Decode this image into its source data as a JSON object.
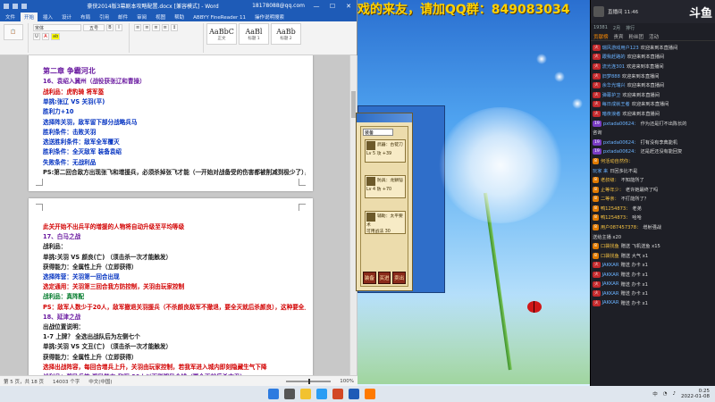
{
  "watermark": "想下载该游戏的来友，请加QQ群：849083034",
  "word": {
    "title": "豪侠2014版3幕剧本攻略配置.docx [兼容模式] - Word",
    "qa_user": "18178088@qq.com",
    "tabs": [
      "文件",
      "开始",
      "插入",
      "设计",
      "布局",
      "引用",
      "邮件",
      "审阅",
      "视图",
      "帮助",
      "ABBYY FineReader 11",
      "操作说明搜索"
    ],
    "font_name": "宋体",
    "font_size": "五号",
    "styles": [
      {
        "sample": "AaBbC",
        "label": "正文"
      },
      {
        "sample": "AaBl",
        "label": "标题 1"
      },
      {
        "sample": "AaBb",
        "label": "标题 2"
      }
    ],
    "page1": [
      {
        "text": "第二章 争霸河北",
        "cls": "chapter"
      },
      {
        "text": "16、袁绍入冀州（战役获张辽和曹操）",
        "cls": "b purple"
      },
      {
        "text": "战利品：虎豹骑 将军盔",
        "cls": "b red"
      },
      {
        "text": "单挑:张辽 VS 关羽(平)",
        "cls": "b blue"
      },
      {
        "text": "胜利力+10",
        "cls": "b blue"
      },
      {
        "text": "选择阵关羽，敌军留下部分战略兵马",
        "cls": "b blue"
      },
      {
        "text": "胜利条件：击败关羽",
        "cls": "b blue"
      },
      {
        "text": "选送胜利条件：敌军全军覆灭",
        "cls": "b blue"
      },
      {
        "text": "胜利条件：全灭敌军 装备袁绍",
        "cls": "b blue"
      },
      {
        "text": "失败条件：无战利品",
        "cls": "b blue"
      },
      {
        "text": "PS:第二回合敌方出现张飞和增援兵，必须杀掉张飞才能（一开始对战备受的伤害都被削减到极少了），关羽才出场",
        "cls": "b"
      }
    ],
    "page2": [
      {
        "text": "此关开始不出兵平的增援的人物将自动升级至平均等级",
        "cls": "b red"
      },
      {
        "text": "17、白马之战",
        "cls": "b purple"
      },
      {
        "text": "战利品：",
        "cls": "b"
      },
      {
        "text": "单挑:关羽 VS 颜良(亡) （须击杀一次才能触发）",
        "cls": "b"
      },
      {
        "text": "获得能力：全属性上升（立即获得）",
        "cls": "b"
      },
      {
        "text": "选择阵营：关羽第一回合出现",
        "cls": "b blue"
      },
      {
        "text": "选定通用：关羽第三回合我方防控制，关羽由玩家控制",
        "cls": "b red"
      },
      {
        "text": "战利品：真阵配",
        "cls": "b green"
      },
      {
        "text": "PS：敌军人数少于20人，敌军撤退关羽援兵（不杀颜良敌军不撤退，要全灭就后杀颜良），这种要全上，不然无法主满敌人20人以下",
        "cls": "b red"
      },
      {
        "text": "18、延津之战",
        "cls": "b purple"
      },
      {
        "text": "出战位置说明：",
        "cls": "b"
      },
      {
        "text": "1-7 上牌？ 全选出战队后为左侧七个",
        "cls": "b"
      },
      {
        "text": "单挑:关羽 VS 文丑(亡) （须击杀一次才能触发）",
        "cls": "b"
      },
      {
        "text": "获得能力：全属性上升（立即获得）",
        "cls": "b"
      },
      {
        "text": "选择出战阵容，每回合增兵上升，关羽由玩家控制，若我军进入城内即刻隐藏生气下降",
        "cls": "b red"
      },
      {
        "text": "战利品：奖励兵符 奖励能力 敌军 30人以下则奖励金钱（要全灭就后杀文丑）",
        "cls": "b purple"
      }
    ],
    "status": {
      "page": "第 5 页，共 18 页",
      "words": "14003 个字",
      "lang": "中文(中国)",
      "zoom": "100%"
    }
  },
  "game": {
    "select": "装备",
    "slots": [
      {
        "name": "武器：古锭刀",
        "stats": "Lv 5 攻 +39"
      },
      {
        "name": "防具：龙鳞铠",
        "stats": "Lv 4 防 +70"
      },
      {
        "name": "辅助：太平要术",
        "stats": "可用战法 30"
      }
    ],
    "buttons": [
      "装备",
      "买进",
      "卖出"
    ]
  },
  "stream": {
    "user": "直播间 11:46",
    "logo": "斗鱼",
    "stats": [
      "19381",
      "2月",
      "排行"
    ],
    "tabs": [
      "贡献榜",
      "贵宾",
      "粉丝团",
      "活动"
    ],
    "messages": [
      {
        "badge": "火",
        "badge_color": "red",
        "name": "瑞风游戏用户123",
        "text": "欢迎来到本直播间"
      },
      {
        "badge": "火",
        "badge_color": "red",
        "name": "跟我赶路的",
        "text": "欢迎来到本直播间"
      },
      {
        "badge": "火",
        "badge_color": "red",
        "name": "流光连301",
        "text": "欢迎来到本直播间"
      },
      {
        "badge": "火",
        "badge_color": "red",
        "name": "旧梦888",
        "text": "欢迎来到本直播间"
      },
      {
        "badge": "火",
        "badge_color": "red",
        "name": "余华光瑞兴",
        "text": "欢迎来到本直播间"
      },
      {
        "badge": "火",
        "badge_color": "red",
        "name": "弹幕护卫",
        "text": "欢迎来到本直播间"
      },
      {
        "badge": "火",
        "badge_color": "red",
        "name": "每日成就王者",
        "text": "欢迎来到本直播间"
      },
      {
        "badge": "火",
        "badge_color": "red",
        "name": "暗夜浪者",
        "text": "欢迎来到本直播间"
      },
      {
        "badge": "19",
        "badge_color": "purple",
        "name": "pxtada00624：",
        "text": "作为还是打不出陈长的"
      },
      {
        "badge": "",
        "badge_color": "gray",
        "name": "",
        "text": "咨询"
      },
      {
        "badge": "19",
        "badge_color": "purple",
        "name": "pxtada00624：",
        "text": "打有没有李典能机"
      },
      {
        "badge": "19",
        "badge_color": "purple",
        "name": "pxtada00624：",
        "text": "还是赶还没有能回复"
      },
      {
        "badge": "8",
        "badge_color": "orange",
        "name": "何活动自然你：",
        "text": ""
      },
      {
        "badge": "",
        "badge_color": "gray",
        "name": "玩家 来",
        "text": "日回多比不是"
      },
      {
        "badge": "8",
        "badge_color": "orange",
        "name": "老叔级：",
        "text": "不知能所了"
      },
      {
        "badge": "8",
        "badge_color": "orange",
        "name": "止等年少：",
        "text": "老许她最终了吗"
      },
      {
        "badge": "8",
        "badge_color": "orange",
        "name": "二等亲：",
        "text": "不打能所了？"
      },
      {
        "badge": "8",
        "badge_color": "orange",
        "name": "鸭1254873：",
        "text": "老弟"
      },
      {
        "badge": "8",
        "badge_color": "orange",
        "name": "鸭1254873：",
        "text": "哈哈"
      },
      {
        "badge": "8",
        "badge_color": "orange",
        "name": "用户087457378：",
        "text": "增射强战"
      },
      {
        "badge": "",
        "badge_color": "gray",
        "name": "",
        "text": "送给主播 x20"
      },
      {
        "badge": "8",
        "badge_color": "orange",
        "name": "口袋找鱼",
        "text": "赠送 飞机送鱼 x15"
      },
      {
        "badge": "8",
        "badge_color": "orange",
        "name": "口袋找鱼",
        "text": "赠送 大气 x1"
      },
      {
        "badge": "火",
        "badge_color": "red",
        "name": "JAKKAR",
        "text": "赠送 办卡 x1"
      },
      {
        "badge": "火",
        "badge_color": "red",
        "name": "JAKKAR",
        "text": "赠送 办卡 x1"
      },
      {
        "badge": "火",
        "badge_color": "red",
        "name": "JAKKAR",
        "text": "赠送 办卡 x1"
      },
      {
        "badge": "火",
        "badge_color": "red",
        "name": "JAKKAR",
        "text": "赠送 办卡 x1"
      },
      {
        "badge": "火",
        "badge_color": "red",
        "name": "JAKKAR",
        "text": "赠送 办卡 x1"
      }
    ]
  },
  "taskbar": {
    "time": "0:25",
    "date": "2022-01-08",
    "tray_text": "中"
  },
  "colors": {
    "word_blue": "#1e5bb7",
    "stream_bg": "#1e1f26",
    "watermark": "#ffd200"
  }
}
